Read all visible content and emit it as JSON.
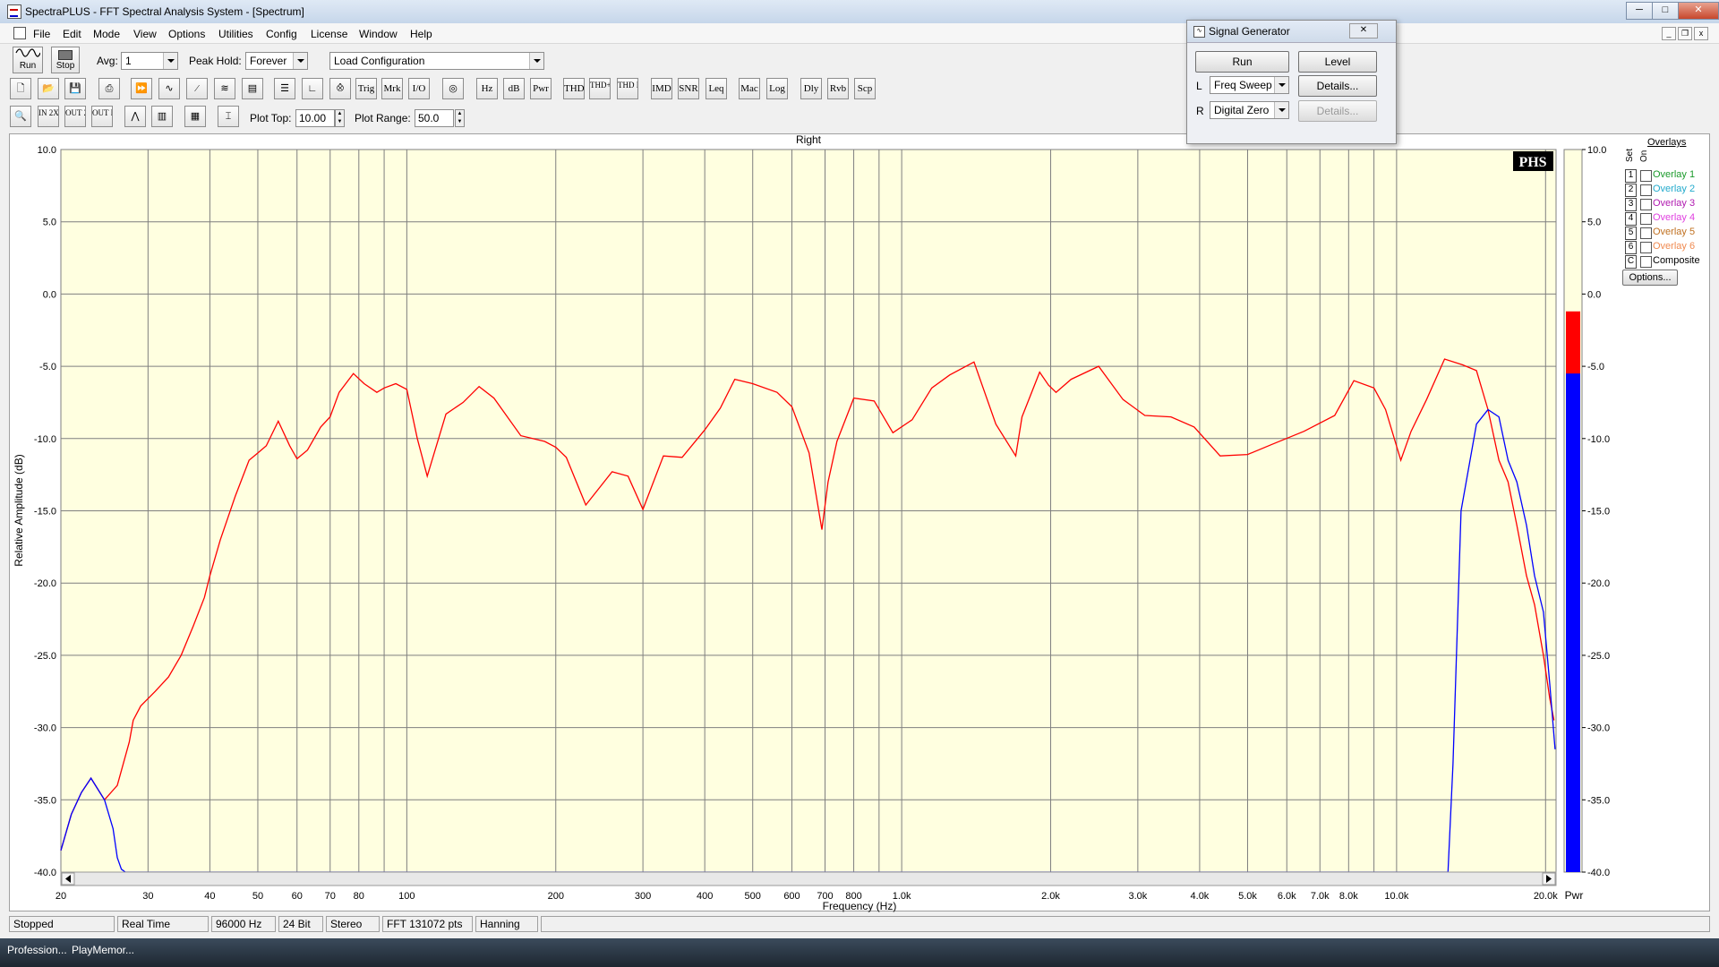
{
  "window": {
    "title": "SpectraPLUS - FFT Spectral Analysis System - [Spectrum]",
    "minimize": "─",
    "maximize": "□",
    "close": "✕",
    "mdi_min": "_",
    "mdi_restore": "❐",
    "mdi_close": "x"
  },
  "menu": [
    "File",
    "Edit",
    "Mode",
    "View",
    "Options",
    "Utilities",
    "Config",
    "License",
    "Window",
    "Help"
  ],
  "toolbar1": {
    "run_label": "Run",
    "stop_label": "Stop",
    "avg_label": "Avg:",
    "avg_value": "1",
    "peakhold_label": "Peak Hold:",
    "peakhold_value": "Forever",
    "loadconfig_value": "Load Configuration"
  },
  "toolbar2": {
    "text_buttons": [
      "Trig",
      "Mrk",
      "I/O",
      "Hz",
      "dB",
      "Pwr",
      "THD",
      "THD+N",
      "THD Freq",
      "IMD",
      "SNR",
      "Leq",
      "Mac",
      "Log",
      "Dly",
      "Rvb",
      "Scp"
    ]
  },
  "toolbar3": {
    "zoom_in_label": "IN 2X",
    "zoom_out_label": "OUT 2X",
    "zoom_full_label": "OUT FULL",
    "plot_top_label": "Plot Top:",
    "plot_top_value": "10.00",
    "plot_range_label": "Plot Range:",
    "plot_range_value": "50.0"
  },
  "signal_generator": {
    "title": "Signal Generator",
    "run_label": "Run",
    "level_label": "Level",
    "left_channel": "L",
    "left_value": "Freq Sweep",
    "right_channel": "R",
    "right_value": "Digital Zero",
    "details_label": "Details...",
    "details_disabled_label": "Details..."
  },
  "overlays": {
    "header": "Overlays",
    "set_label": "Set",
    "on_label": "On",
    "items": [
      {
        "num": "1",
        "label": "Overlay 1",
        "color": "#1a9a2a"
      },
      {
        "num": "2",
        "label": "Overlay 2",
        "color": "#22aacc"
      },
      {
        "num": "3",
        "label": "Overlay 3",
        "color": "#b01ab0"
      },
      {
        "num": "4",
        "label": "Overlay 4",
        "color": "#e040e0"
      },
      {
        "num": "5",
        "label": "Overlay 5",
        "color": "#c07020"
      },
      {
        "num": "6",
        "label": "Overlay 6",
        "color": "#f08a50"
      },
      {
        "num": "C",
        "label": "Composite",
        "color": "#000000"
      }
    ],
    "options_label": "Options..."
  },
  "status": [
    "Stopped",
    "Real Time",
    "96000 Hz",
    "24 Bit",
    "Stereo",
    "FFT 131072 pts",
    "Hanning"
  ],
  "taskbar": [
    "Profession...",
    "PlayMemor..."
  ],
  "chart_data": {
    "type": "line",
    "title": "Right",
    "xlabel": "Frequency (Hz)",
    "ylabel": "Relative Amplitude (dB)",
    "xscale": "log",
    "xlim": [
      20,
      21000
    ],
    "ylim": [
      -40,
      10
    ],
    "grid": true,
    "logo": "PHS",
    "x_tick_labels": [
      {
        "v": 20,
        "t": "20"
      },
      {
        "v": 30,
        "t": "30"
      },
      {
        "v": 40,
        "t": "40"
      },
      {
        "v": 50,
        "t": "50"
      },
      {
        "v": 60,
        "t": "60"
      },
      {
        "v": 70,
        "t": "70"
      },
      {
        "v": 80,
        "t": "80"
      },
      {
        "v": 100,
        "t": "100"
      },
      {
        "v": 200,
        "t": "200"
      },
      {
        "v": 300,
        "t": "300"
      },
      {
        "v": 400,
        "t": "400"
      },
      {
        "v": 500,
        "t": "500"
      },
      {
        "v": 600,
        "t": "600"
      },
      {
        "v": 700,
        "t": "700"
      },
      {
        "v": 800,
        "t": "800"
      },
      {
        "v": 1000,
        "t": "1.0k"
      },
      {
        "v": 2000,
        "t": "2.0k"
      },
      {
        "v": 3000,
        "t": "3.0k"
      },
      {
        "v": 4000,
        "t": "4.0k"
      },
      {
        "v": 5000,
        "t": "5.0k"
      },
      {
        "v": 6000,
        "t": "6.0k"
      },
      {
        "v": 7000,
        "t": "7.0k"
      },
      {
        "v": 8000,
        "t": "8.0k"
      },
      {
        "v": 10000,
        "t": "10.0k"
      },
      {
        "v": 20000,
        "t": "20.0k"
      }
    ],
    "x_grid_extra": [
      90,
      900,
      9000
    ],
    "y_ticks": [
      10,
      5,
      0,
      -5,
      -10,
      -15,
      -20,
      -25,
      -30,
      -35,
      -40
    ],
    "y_tick_labels": [
      "10.0",
      "5.0",
      "0.0",
      "-5.0",
      "-10.0",
      "-15.0",
      "-20.0",
      "-25.0",
      "-30.0",
      "-35.0",
      "-40.0"
    ],
    "series": [
      {
        "color": "#ff0000",
        "x": [
          20,
          21,
          22,
          23,
          24.5,
          26,
          27.5,
          28,
          29,
          31,
          33,
          35,
          37,
          39,
          40,
          42,
          45,
          48,
          50,
          52,
          55,
          58,
          60,
          63,
          67,
          70,
          73,
          78,
          82,
          87,
          90,
          95,
          100,
          105,
          110,
          120,
          130,
          140,
          150,
          170,
          190,
          200,
          210,
          230,
          260,
          280,
          300,
          330,
          360,
          400,
          430,
          460,
          500,
          560,
          600,
          650,
          690,
          710,
          740,
          800,
          880,
          960,
          1050,
          1150,
          1250,
          1400,
          1550,
          1700,
          1750,
          1900,
          1980,
          2050,
          2200,
          2500,
          2800,
          3100,
          3500,
          3900,
          4400,
          5000,
          5600,
          6500,
          7500,
          8200,
          9000,
          9500,
          10200,
          10700,
          11500,
          12500,
          13600,
          14500,
          15300,
          16100,
          16800,
          17500,
          18300,
          19000,
          19800,
          20400,
          20800
        ],
        "y": [
          -38.5,
          -36,
          -34.5,
          -33.5,
          -35,
          -34,
          -31,
          -29.5,
          -28.5,
          -27.5,
          -26.5,
          -25,
          -23,
          -21,
          -19.5,
          -17,
          -14,
          -11.5,
          -11,
          -10.5,
          -8.8,
          -10.5,
          -11.4,
          -10.8,
          -9.2,
          -8.5,
          -6.8,
          -5.5,
          -6.2,
          -6.8,
          -6.5,
          -6.2,
          -6.6,
          -10,
          -12.6,
          -8.3,
          -7.5,
          -6.4,
          -7.2,
          -9.8,
          -10.2,
          -10.6,
          -11.3,
          -14.6,
          -12.3,
          -12.6,
          -14.9,
          -11.2,
          -11.3,
          -9.4,
          -7.9,
          -5.9,
          -6.2,
          -6.8,
          -7.8,
          -11,
          -16.3,
          -13,
          -10.2,
          -7.2,
          -7.4,
          -9.6,
          -8.7,
          -6.5,
          -5.6,
          -4.7,
          -9,
          -11.2,
          -8.5,
          -5.4,
          -6.3,
          -6.8,
          -5.9,
          -5,
          -7.3,
          -8.4,
          -8.5,
          -9.2,
          -11.2,
          -11.1,
          -10.4,
          -9.5,
          -8.4,
          -6,
          -6.5,
          -8,
          -11.5,
          -9.5,
          -7.3,
          -4.5,
          -4.9,
          -5.3,
          -8,
          -11.5,
          -13,
          -16,
          -19.5,
          -21.5,
          -25,
          -28,
          -29.5
        ]
      },
      {
        "color": "#0000ff",
        "x": [
          20,
          21,
          22,
          23,
          24.5,
          25.5,
          26,
          26.5,
          27,
          28,
          29,
          12700,
          13000,
          13500,
          14500,
          15300,
          16100,
          16800,
          17500,
          18300,
          19000,
          19800,
          20400,
          20900
        ],
        "y": [
          -38.5,
          -36,
          -34.5,
          -33.5,
          -35,
          -37,
          -39,
          -39.8,
          -40,
          -40,
          -40,
          -40,
          -32.5,
          -15,
          -9,
          -8,
          -8.5,
          -11.5,
          -13,
          -16,
          -19.5,
          -22,
          -27,
          -31.5
        ]
      }
    ]
  },
  "level_meter": {
    "label": "Pwr",
    "red_top_db": -1.2,
    "blue_top_db": -5.5,
    "tick_labels": [
      "10.0",
      "5.0",
      "0.0",
      "-5.0",
      "-10.0",
      "-15.0",
      "-20.0",
      "-25.0",
      "-30.0",
      "-35.0",
      "-40.0"
    ],
    "red_color": "#ff0000",
    "blue_color": "#0000ff"
  }
}
